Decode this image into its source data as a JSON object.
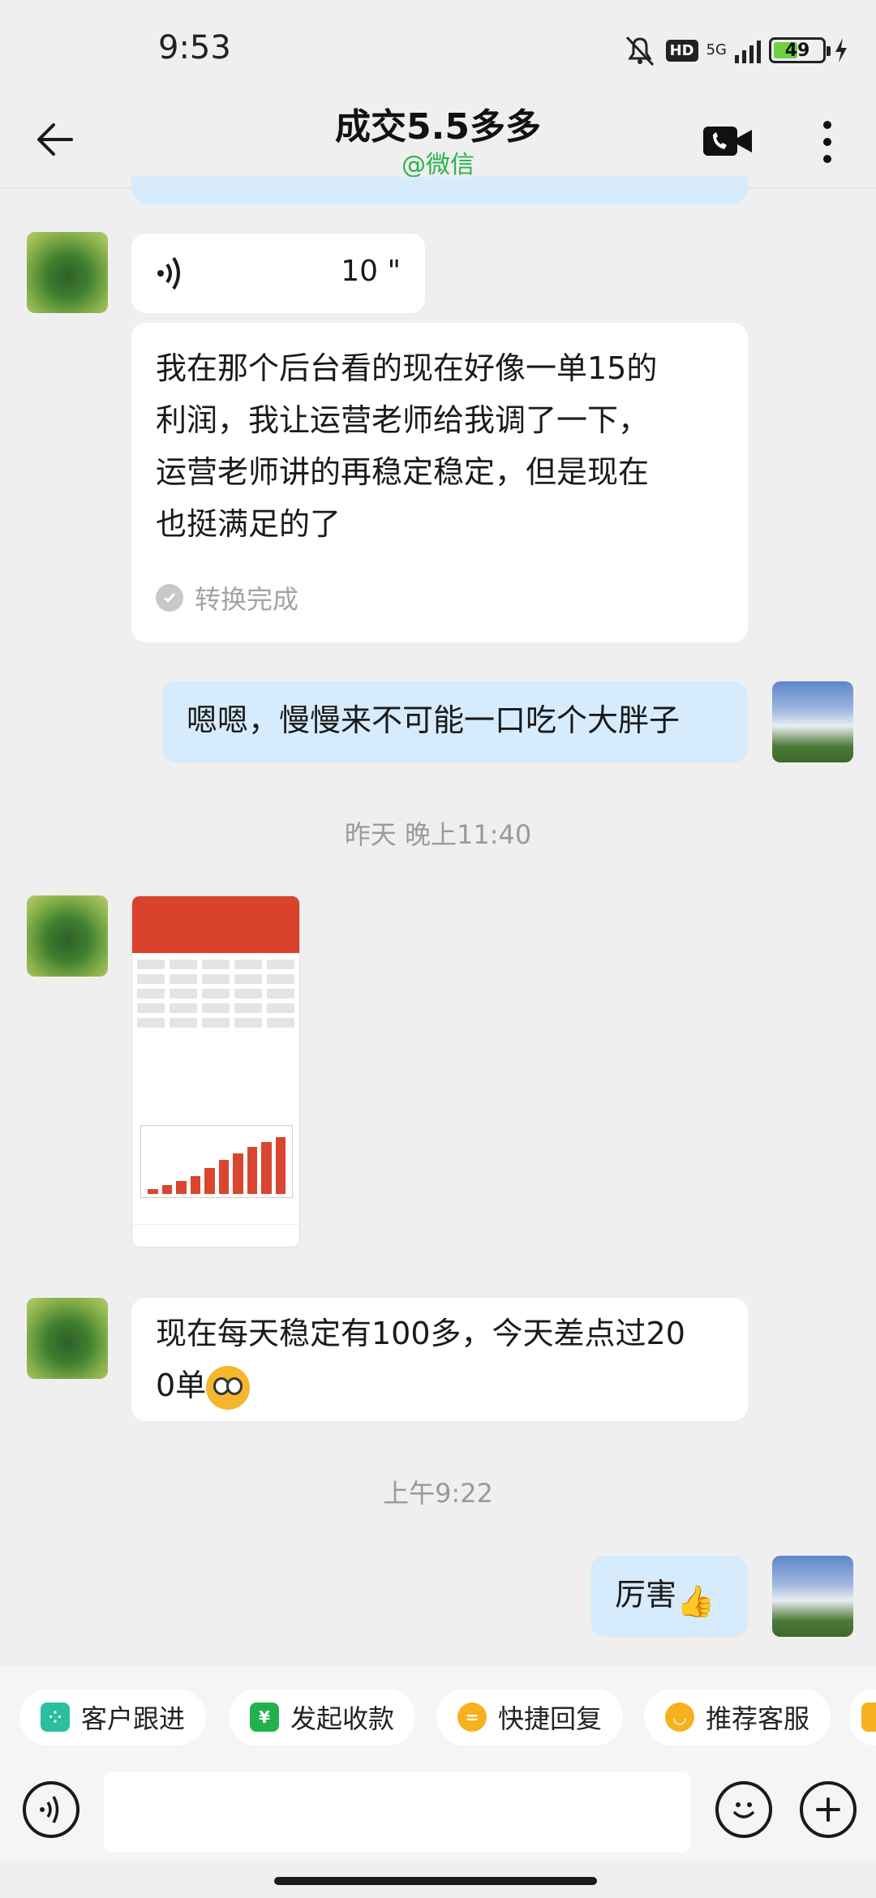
{
  "status_bar": {
    "time": "9:53",
    "hd": "HD",
    "network": "5G",
    "battery": "49"
  },
  "header": {
    "title": "成交5.5多多",
    "subtitle": "@微信"
  },
  "messages": {
    "voice": {
      "duration": "10 \""
    },
    "long_text": {
      "line1": "我在那个后台看的现在好像一单15的",
      "line2": "利润，我让运营老师给我调了一下，",
      "line3": "运营老师讲的再稳定稳定，但是现在",
      "line4": "也挺满足的了",
      "status": "转换完成"
    },
    "reply1": "嗯嗯，慢慢来不可能一口吃个大胖子",
    "timestamp1": "昨天 晚上11:40",
    "text200": {
      "line1": "现在每天稳定有100多，今天差点过20",
      "line2": "0单"
    },
    "timestamp2": "上午9:22",
    "reply2": "厉害"
  },
  "quick_actions": [
    {
      "label": "客户跟进",
      "icon": "customer-follow-icon",
      "color": "#2bbfa0"
    },
    {
      "label": "发起收款",
      "icon": "payment-icon",
      "color": "#22b14c"
    },
    {
      "label": "快捷回复",
      "icon": "quick-reply-icon",
      "color": "#f5b11e"
    },
    {
      "label": "推荐客服",
      "icon": "recommend-service-icon",
      "color": "#f5b11e"
    }
  ]
}
